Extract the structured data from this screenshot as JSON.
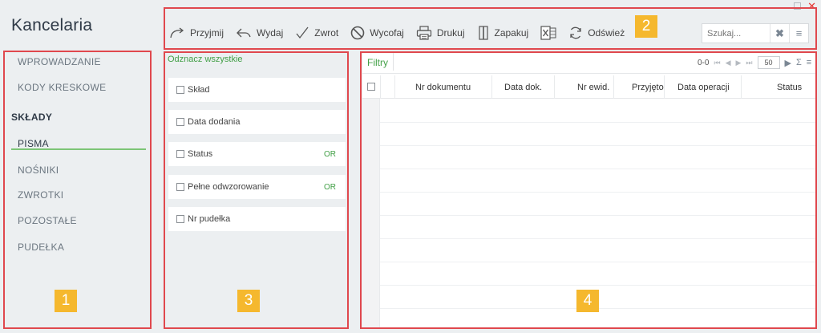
{
  "app": {
    "title": "Kancelaria"
  },
  "toolbar": {
    "buttons": [
      {
        "label": "Przyjmij",
        "icon": "redo-arrow-icon"
      },
      {
        "label": "Wydaj",
        "icon": "undo-arrow-icon"
      },
      {
        "label": "Zwrot",
        "icon": "checkmark-icon"
      },
      {
        "label": "Wycofaj",
        "icon": "prohibited-icon"
      },
      {
        "label": "Drukuj",
        "icon": "printer-icon"
      },
      {
        "label": "Zapakuj",
        "icon": "package-icon"
      },
      {
        "label": "",
        "icon": "excel-export-icon"
      },
      {
        "label": "Odśwież",
        "icon": "refresh-icon"
      }
    ],
    "search_placeholder": "Szukaj...",
    "search_clear": "✖",
    "search_menu": "≡"
  },
  "sidebar": {
    "items": [
      {
        "label": "WPROWADZANIE"
      },
      {
        "label": "KODY KRESKOWE"
      }
    ],
    "section": "SKŁADY",
    "subitems": [
      {
        "label": "PISMA",
        "active": true
      },
      {
        "label": "NOŚNIKI"
      },
      {
        "label": "ZWROTKI"
      },
      {
        "label": "POZOSTAŁE"
      },
      {
        "label": "PUDEŁKA"
      }
    ]
  },
  "filters": {
    "select_all": "Odznacz wszystkie",
    "rows": [
      {
        "label": "Skład",
        "tag": ""
      },
      {
        "label": "Data dodania",
        "tag": ""
      },
      {
        "label": "Status",
        "tag": "OR"
      },
      {
        "label": "Pełne odwzorowanie",
        "tag": "OR"
      },
      {
        "label": "Nr pudełka",
        "tag": ""
      }
    ]
  },
  "grid": {
    "filter_tab": "Filtry",
    "pager": {
      "range": "0-0",
      "page_size": "50",
      "sum_icon": "Σ"
    },
    "columns": [
      "Nr dokumentu",
      "Data dok.",
      "Nr ewid.",
      "Przyjęto",
      "Data operacji",
      "Status"
    ]
  },
  "callouts": [
    "1",
    "2",
    "3",
    "4"
  ],
  "colors": {
    "accent_green": "#43a047",
    "frame_red": "#e0484e",
    "badge_yellow": "#f5b82e"
  }
}
